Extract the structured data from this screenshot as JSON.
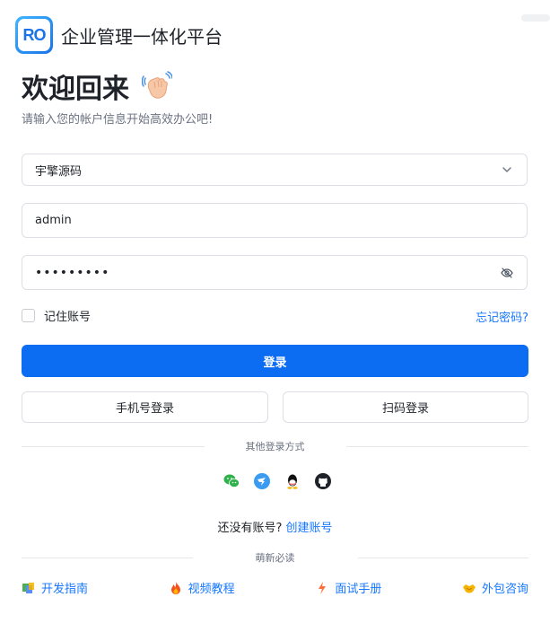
{
  "header": {
    "logo_text": "RO",
    "title": "企业管理一体化平台"
  },
  "welcome": {
    "heading": "欢迎回来",
    "subtitle": "请输入您的帐户信息开始高效办公吧!"
  },
  "form": {
    "tenant_value": "宇擎源码",
    "username_value": "admin",
    "password_value": "•••••••••",
    "remember_label": "记住账号",
    "forgot_label": "忘记密码?",
    "login_button": "登录",
    "phone_login_button": "手机号登录",
    "qr_login_button": "扫码登录"
  },
  "other_login": {
    "divider_text": "其他登录方式",
    "icons": [
      "wechat-icon",
      "dingtalk-icon",
      "qq-icon",
      "github-icon"
    ]
  },
  "signup": {
    "prompt": "还没有账号?",
    "link": "创建账号"
  },
  "newbie": {
    "divider_text": "萌新必读",
    "links": [
      {
        "label": "开发指南",
        "icon": "book-icon"
      },
      {
        "label": "视频教程",
        "icon": "fire-icon"
      },
      {
        "label": "面试手册",
        "icon": "lightning-icon"
      },
      {
        "label": "外包咨询",
        "icon": "handshake-icon"
      }
    ]
  },
  "colors": {
    "primary": "#0c6cf2",
    "link": "#1677ff"
  }
}
